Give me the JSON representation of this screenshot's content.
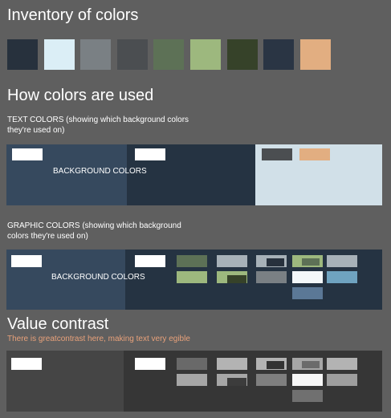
{
  "title_inventory": "Inventory of colors",
  "title_usage": "How colors are used",
  "text_caption": "TEXT COLORS (showing which background colors they're used on)",
  "graphic_caption": "GRAPHIC COLORS (showing which background colors they're used on)",
  "background_label": "BACKGROUND COLORS",
  "title_contrast": "Value contrast",
  "contrast_note": "There is greatcontrast here, making text very egible",
  "palette": [
    "#27313d",
    "#dbeef6",
    "#7a8084",
    "#4b4e51",
    "#5d7156",
    "#9db87e",
    "#364229",
    "#2a3544",
    "#e2ae81"
  ],
  "colors": {
    "page_bg": "#5f5f5f",
    "bg_blue": "#36495e",
    "bg_navy": "#253342",
    "bg_light": "#d1e0e8",
    "white": "#ffffff",
    "note_orange": "#e8a17a",
    "steel": "#5b7896",
    "light_blue": "#6fa3c0",
    "grey_mid": "#7a7f82",
    "grey_light": "#a7b1b8",
    "contrast_dark": "#454545",
    "contrast_darker": "#363636"
  }
}
